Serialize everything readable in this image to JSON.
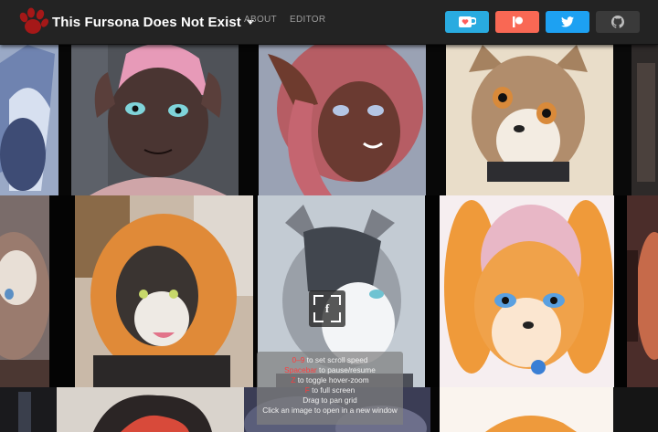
{
  "header": {
    "title": "This Fursona Does Not Exist",
    "nav": {
      "about": "ABOUT",
      "editor": "EDITOR"
    },
    "buttons": [
      {
        "name": "kofi",
        "icon": "ko-fi-cup-icon",
        "color": "#29abe0"
      },
      {
        "name": "patreon",
        "icon": "patreon-icon",
        "color": "#f96854"
      },
      {
        "name": "twitter",
        "icon": "twitter-bird-icon",
        "color": "#1da1f2"
      },
      {
        "name": "github",
        "icon": "github-icon",
        "color": "#3a3a3a"
      }
    ]
  },
  "help": {
    "lines": [
      {
        "key": "0–9",
        "text": " to set scroll speed"
      },
      {
        "key": "Spacebar",
        "text": " to pause/resume"
      },
      {
        "key": "Z",
        "text": " to toggle hover-zoom"
      },
      {
        "key": "F",
        "text": " to full screen"
      },
      {
        "key": "",
        "text": "Drag to pan grid"
      },
      {
        "key": "",
        "text": "Click an image to open in a new window"
      }
    ]
  },
  "colors": {
    "topbar": "#232323",
    "background": "#151515",
    "accent_red": "#ff3b3b"
  }
}
